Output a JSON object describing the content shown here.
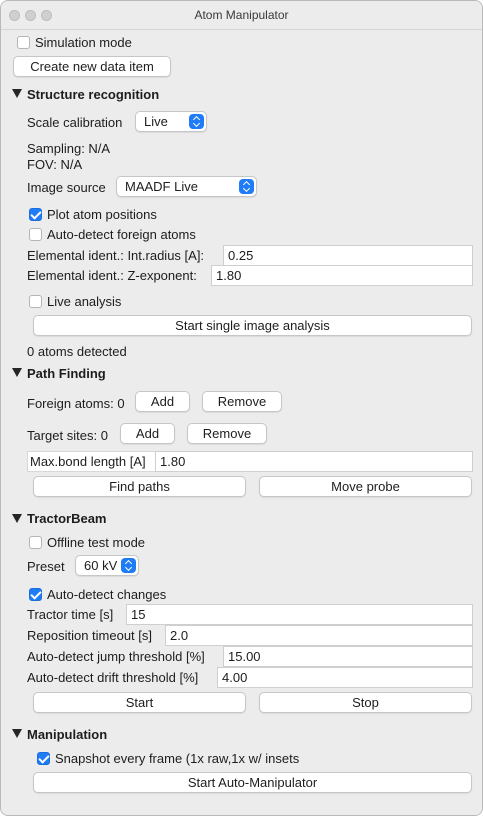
{
  "window": {
    "title": "Atom Manipulator"
  },
  "simulation_mode": {
    "label": "Simulation mode",
    "checked": false
  },
  "create_button": "Create new data item",
  "structure": {
    "heading": "Structure recognition",
    "scale_label": "Scale calibration",
    "scale_value": "Live",
    "sampling": "Sampling: N/A",
    "fov": "FOV: N/A",
    "image_source_label": "Image source",
    "image_source_value": "MAADF Live",
    "plot_atoms": {
      "label": "Plot atom positions",
      "checked": true
    },
    "auto_foreign": {
      "label": "Auto-detect foreign atoms",
      "checked": false
    },
    "int_radius_label": "Elemental ident.: Int.radius [A]:",
    "int_radius_value": "0.25",
    "z_exp_label": "Elemental ident.: Z-exponent:",
    "z_exp_value": "1.80",
    "live_analysis": {
      "label": "Live analysis",
      "checked": false
    },
    "start_single": "Start single image analysis",
    "atoms_detected": "0 atoms detected"
  },
  "path": {
    "heading": "Path Finding",
    "foreign_label": "Foreign atoms: 0",
    "target_label": "Target sites: 0",
    "add": "Add",
    "remove": "Remove",
    "bond_label": "Max.bond length [A]",
    "bond_value": "1.80",
    "find_paths": "Find paths",
    "move_probe": "Move probe"
  },
  "tractor": {
    "heading": "TractorBeam",
    "offline": {
      "label": "Offline test mode",
      "checked": false
    },
    "preset_label": "Preset",
    "preset_value": "60 kV",
    "auto_changes": {
      "label": "Auto-detect changes",
      "checked": true
    },
    "time_label": "Tractor time [s]",
    "time_value": "15",
    "reposition_label": "Reposition timeout [s]",
    "reposition_value": "2.0",
    "jump_label": "Auto-detect jump threshold [%]",
    "jump_value": "15.00",
    "drift_label": "Auto-detect drift threshold [%]",
    "drift_value": "4.00",
    "start": "Start",
    "stop": "Stop"
  },
  "manip": {
    "heading": "Manipulation",
    "snapshot": {
      "label": "Snapshot every frame (1x raw,1x w/ insets",
      "checked": true
    },
    "start_auto": "Start Auto-Manipulator"
  }
}
